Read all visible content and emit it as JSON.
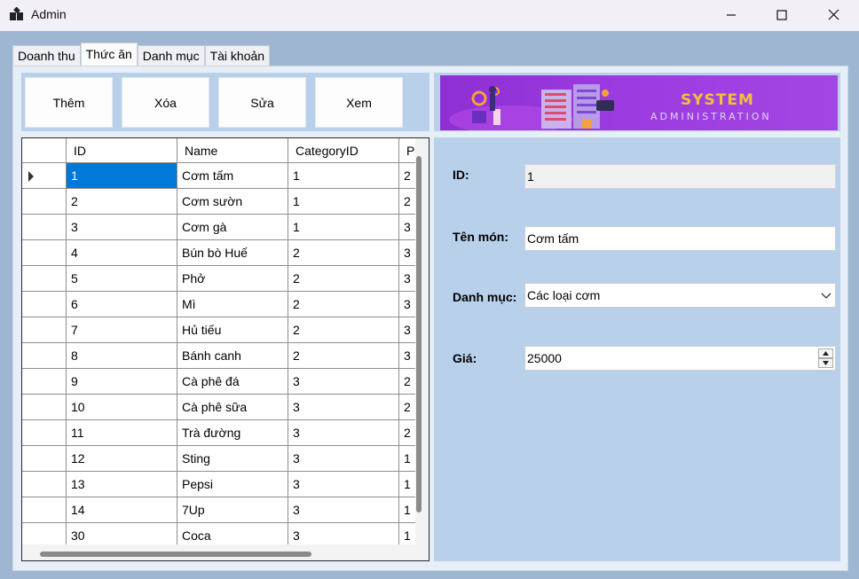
{
  "window": {
    "title": "Admin"
  },
  "tabs": [
    {
      "label": "Doanh thu"
    },
    {
      "label": "Thức ăn"
    },
    {
      "label": "Danh mục"
    },
    {
      "label": "Tài khoản"
    }
  ],
  "active_tab": "Thức ăn",
  "toolbar": {
    "add_label": "Thêm",
    "delete_label": "Xóa",
    "edit_label": "Sửa",
    "view_label": "Xem"
  },
  "banner": {
    "title": "SYSTEM",
    "subtitle": "ADMINISTRATION"
  },
  "grid": {
    "columns": [
      "ID",
      "Name",
      "CategoryID",
      "P"
    ],
    "rows": [
      {
        "id": "1",
        "name": "Cơm tấm",
        "category": "1",
        "p": "2"
      },
      {
        "id": "2",
        "name": "Cơm sườn",
        "category": "1",
        "p": "2"
      },
      {
        "id": "3",
        "name": "Cơm gà",
        "category": "1",
        "p": "3"
      },
      {
        "id": "4",
        "name": "Bún bò Huế",
        "category": "2",
        "p": "3"
      },
      {
        "id": "5",
        "name": "Phở",
        "category": "2",
        "p": "3"
      },
      {
        "id": "6",
        "name": "Mì",
        "category": "2",
        "p": "3"
      },
      {
        "id": "7",
        "name": "Hủ tiếu",
        "category": "2",
        "p": "3"
      },
      {
        "id": "8",
        "name": "Bánh canh",
        "category": "2",
        "p": "3"
      },
      {
        "id": "9",
        "name": "Cà phê đá",
        "category": "3",
        "p": "2"
      },
      {
        "id": "10",
        "name": "Cà phê sữa",
        "category": "3",
        "p": "2"
      },
      {
        "id": "11",
        "name": "Trà đường",
        "category": "3",
        "p": "2"
      },
      {
        "id": "12",
        "name": "Sting",
        "category": "3",
        "p": "1"
      },
      {
        "id": "13",
        "name": "Pepsi",
        "category": "3",
        "p": "1"
      },
      {
        "id": "14",
        "name": "7Up",
        "category": "3",
        "p": "1"
      },
      {
        "id": "30",
        "name": "Coca",
        "category": "3",
        "p": "1"
      }
    ],
    "selected_row": 0
  },
  "form": {
    "id_label": "ID:",
    "id_value": "1",
    "name_label": "Tên món:",
    "name_value": "Cơm tấm",
    "category_label": "Danh mục:",
    "category_value": "Các loại cơm",
    "price_label": "Giá:",
    "price_value": "25000"
  },
  "colors": {
    "selection": "#0078d7",
    "panel": "#b9d0ea",
    "banner": "#9c3be0",
    "banner_title": "#f4c136"
  }
}
